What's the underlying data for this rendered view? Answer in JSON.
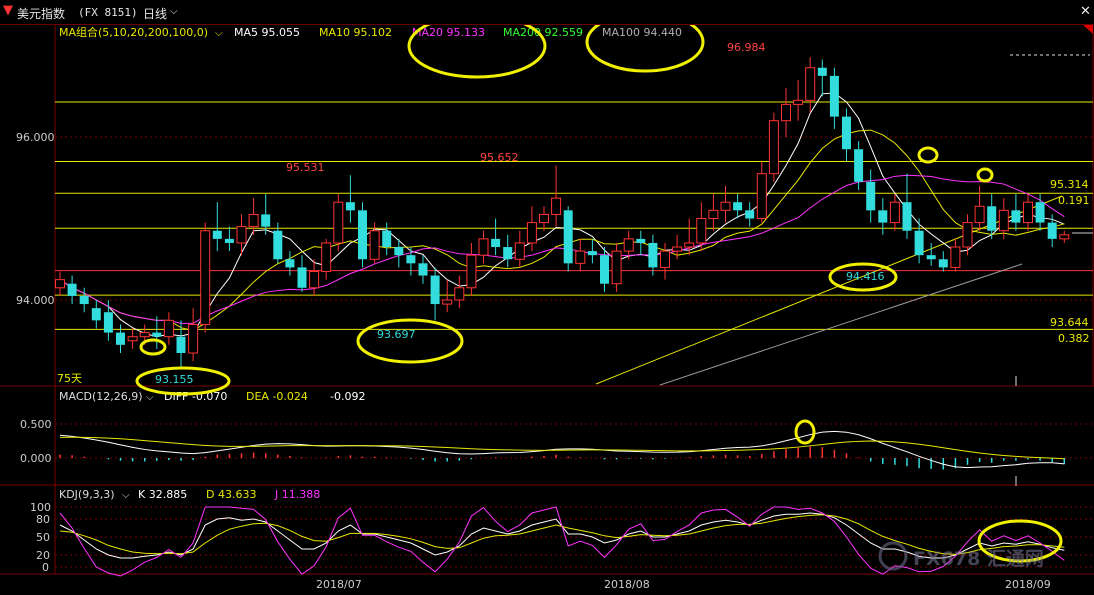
{
  "header": {
    "title": "美元指数",
    "symbol": "(FX 8151)",
    "period": "日线"
  },
  "ma_legend": {
    "name": "MA组合(5,10,20,200,100,0)",
    "items": [
      {
        "label": "MA5 95.055",
        "color": "#ffffff"
      },
      {
        "label": "MA10 95.102",
        "color": "#e8e800"
      },
      {
        "label": "MA20 95.133",
        "color": "#ff33ff"
      },
      {
        "label": "MA200 92.559",
        "color": "#33ff33"
      },
      {
        "label": "MA100 94.440",
        "color": "#b0b0b0"
      }
    ]
  },
  "price_axis": [
    "96.000",
    "94.000"
  ],
  "annotations": {
    "high1": "95.531",
    "high2": "95.652",
    "high3": "96.984",
    "low1": "93.155",
    "low2": "93.697",
    "low3": "94.416",
    "fib_high": "95.314",
    "fib_high_ratio": "0.191",
    "fib_low": "93.644",
    "fib_low_ratio": "0.382",
    "days": "75天"
  },
  "macd": {
    "legend": "MACD(12,26,9)",
    "diff": "DIFF -0.070",
    "dea": "DEA -0.024",
    "macd": "-0.092",
    "axis": [
      "0.500",
      "0.000"
    ]
  },
  "kdj": {
    "legend": "KDJ(9,3,3)",
    "k": "K 32.885",
    "d": "D 43.633",
    "j": "J 11.388",
    "axis": [
      "100",
      "80",
      "50",
      "20",
      "0"
    ]
  },
  "x_axis": [
    "2018/07",
    "2018/08",
    "2018/09"
  ],
  "watermark": "FX678 汇通网",
  "chart_data": {
    "type": "candlestick",
    "title": "美元指数 (FX 8151) 日线",
    "ylim": [
      93.0,
      97.3
    ],
    "candles": [
      [
        94.15,
        94.25,
        94.05,
        94.35
      ],
      [
        94.2,
        94.05,
        93.95,
        94.3
      ],
      [
        94.05,
        93.95,
        93.85,
        94.15
      ],
      [
        93.9,
        93.75,
        93.65,
        94.0
      ],
      [
        93.85,
        93.6,
        93.5,
        94.0
      ],
      [
        93.6,
        93.45,
        93.35,
        93.7
      ],
      [
        93.5,
        93.55,
        93.4,
        93.65
      ],
      [
        93.55,
        93.6,
        93.45,
        93.7
      ],
      [
        93.6,
        93.55,
        93.4,
        93.8
      ],
      [
        93.55,
        93.75,
        93.45,
        93.85
      ],
      [
        93.55,
        93.35,
        93.16,
        93.75
      ],
      [
        93.35,
        93.7,
        93.25,
        93.9
      ],
      [
        93.7,
        94.85,
        93.6,
        94.95
      ],
      [
        94.85,
        94.75,
        94.6,
        95.2
      ],
      [
        94.75,
        94.7,
        94.6,
        94.9
      ],
      [
        94.7,
        94.9,
        94.55,
        95.05
      ],
      [
        94.9,
        95.05,
        94.8,
        95.25
      ],
      [
        95.05,
        94.9,
        94.8,
        95.3
      ],
      [
        94.85,
        94.5,
        94.45,
        94.95
      ],
      [
        94.5,
        94.4,
        94.3,
        94.6
      ],
      [
        94.4,
        94.15,
        94.1,
        94.55
      ],
      [
        94.15,
        94.35,
        94.05,
        94.5
      ],
      [
        94.35,
        94.7,
        94.25,
        94.75
      ],
      [
        94.7,
        95.2,
        94.6,
        95.3
      ],
      [
        95.2,
        95.1,
        94.95,
        95.53
      ],
      [
        95.1,
        94.5,
        94.4,
        95.2
      ],
      [
        94.5,
        94.85,
        94.45,
        94.95
      ],
      [
        94.85,
        94.65,
        94.55,
        94.95
      ],
      [
        94.65,
        94.55,
        94.4,
        94.75
      ],
      [
        94.55,
        94.45,
        94.3,
        94.65
      ],
      [
        94.45,
        94.3,
        94.2,
        94.55
      ],
      [
        94.3,
        93.95,
        93.75,
        94.4
      ],
      [
        93.95,
        94.0,
        93.85,
        94.25
      ],
      [
        94.0,
        94.15,
        93.9,
        94.3
      ],
      [
        94.15,
        94.55,
        94.05,
        94.7
      ],
      [
        94.55,
        94.75,
        94.45,
        94.85
      ],
      [
        94.75,
        94.65,
        94.55,
        95.0
      ],
      [
        94.65,
        94.5,
        94.4,
        94.8
      ],
      [
        94.5,
        94.7,
        94.4,
        94.85
      ],
      [
        94.7,
        94.95,
        94.6,
        95.15
      ],
      [
        94.95,
        95.05,
        94.85,
        95.15
      ],
      [
        95.05,
        95.25,
        94.9,
        95.65
      ],
      [
        95.1,
        94.45,
        94.35,
        95.15
      ],
      [
        94.45,
        94.6,
        94.35,
        94.75
      ],
      [
        94.6,
        94.55,
        94.45,
        94.75
      ],
      [
        94.55,
        94.2,
        94.1,
        94.65
      ],
      [
        94.2,
        94.6,
        94.1,
        94.7
      ],
      [
        94.6,
        94.75,
        94.5,
        94.85
      ],
      [
        94.75,
        94.7,
        94.55,
        94.85
      ],
      [
        94.7,
        94.4,
        94.3,
        94.8
      ],
      [
        94.4,
        94.6,
        94.25,
        94.7
      ],
      [
        94.6,
        94.65,
        94.5,
        94.8
      ],
      [
        94.65,
        94.7,
        94.55,
        95.0
      ],
      [
        94.7,
        95.0,
        94.6,
        95.2
      ],
      [
        95.0,
        95.1,
        94.85,
        95.3
      ],
      [
        95.1,
        95.2,
        94.95,
        95.4
      ],
      [
        95.2,
        95.1,
        95.0,
        95.3
      ],
      [
        95.1,
        95.0,
        94.9,
        95.2
      ],
      [
        95.0,
        95.55,
        94.95,
        95.7
      ],
      [
        95.55,
        96.2,
        95.45,
        96.3
      ],
      [
        96.2,
        96.4,
        96.0,
        96.6
      ],
      [
        96.4,
        96.45,
        96.2,
        96.7
      ],
      [
        96.45,
        96.85,
        96.3,
        96.98
      ],
      [
        96.85,
        96.75,
        96.5,
        96.95
      ],
      [
        96.75,
        96.25,
        96.1,
        96.85
      ],
      [
        96.25,
        95.85,
        95.7,
        96.35
      ],
      [
        95.85,
        95.45,
        95.35,
        95.95
      ],
      [
        95.45,
        95.1,
        94.95,
        95.6
      ],
      [
        95.1,
        94.95,
        94.8,
        95.25
      ],
      [
        94.95,
        95.2,
        94.85,
        95.3
      ],
      [
        95.2,
        94.85,
        94.75,
        95.55
      ],
      [
        94.85,
        94.55,
        94.45,
        95.0
      ],
      [
        94.55,
        94.5,
        94.42,
        94.7
      ],
      [
        94.5,
        94.4,
        94.35,
        94.6
      ],
      [
        94.4,
        94.65,
        94.35,
        94.75
      ],
      [
        94.65,
        94.95,
        94.55,
        95.05
      ],
      [
        94.95,
        95.15,
        94.85,
        95.4
      ],
      [
        95.15,
        94.85,
        94.75,
        95.3
      ],
      [
        94.85,
        95.1,
        94.75,
        95.25
      ],
      [
        95.1,
        94.95,
        94.85,
        95.3
      ],
      [
        94.95,
        95.2,
        94.85,
        95.3
      ],
      [
        95.2,
        94.95,
        94.85,
        95.3
      ],
      [
        94.95,
        94.75,
        94.65,
        95.05
      ],
      [
        94.75,
        94.8,
        94.7,
        94.85
      ]
    ],
    "horizontal_levels": [
      {
        "value": 96.43,
        "color": "#e8e800"
      },
      {
        "value": 95.7,
        "color": "#e8e800"
      },
      {
        "value": 95.31,
        "color": "#e8e800"
      },
      {
        "value": 94.88,
        "color": "#e8e800"
      },
      {
        "value": 94.36,
        "color": "#ff3333"
      },
      {
        "value": 94.06,
        "color": "#e8e800"
      },
      {
        "value": 93.64,
        "color": "#e8e800"
      }
    ],
    "macd_bars": [
      0.05,
      0.04,
      0.02,
      0,
      -0.02,
      -0.04,
      -0.05,
      -0.05,
      -0.04,
      -0.03,
      -0.04,
      -0.03,
      0.02,
      0.05,
      0.06,
      0.07,
      0.08,
      0.07,
      0.05,
      0.03,
      0.01,
      0,
      0.01,
      0.03,
      0.04,
      0.02,
      0.02,
      0.01,
      0,
      -0.01,
      -0.03,
      -0.05,
      -0.05,
      -0.04,
      -0.02,
      0,
      0.01,
      0,
      0,
      0.02,
      0.03,
      0.05,
      0.02,
      0.01,
      0,
      -0.02,
      -0.02,
      -0.01,
      -0.01,
      -0.02,
      -0.01,
      0,
      0.01,
      0.03,
      0.04,
      0.05,
      0.04,
      0.03,
      0.06,
      0.1,
      0.13,
      0.15,
      0.17,
      0.16,
      0.12,
      0.07,
      0.01,
      -0.05,
      -0.09,
      -0.1,
      -0.12,
      -0.15,
      -0.16,
      -0.17,
      -0.15,
      -0.1,
      -0.06,
      -0.07,
      -0.04,
      -0.04,
      -0.02,
      -0.04,
      -0.06,
      -0.09
    ],
    "kdj_k": [
      70,
      60,
      45,
      30,
      20,
      15,
      15,
      18,
      20,
      25,
      20,
      30,
      70,
      80,
      82,
      78,
      80,
      75,
      60,
      45,
      30,
      30,
      40,
      60,
      70,
      55,
      55,
      50,
      45,
      40,
      30,
      20,
      25,
      35,
      55,
      65,
      60,
      55,
      60,
      70,
      75,
      80,
      55,
      55,
      50,
      40,
      45,
      55,
      60,
      50,
      50,
      55,
      60,
      70,
      75,
      78,
      75,
      70,
      78,
      85,
      88,
      88,
      90,
      88,
      82,
      70,
      55,
      40,
      30,
      30,
      25,
      18,
      15,
      15,
      20,
      30,
      40,
      35,
      40,
      38,
      42,
      38,
      32,
      28
    ],
    "kdj_d": [
      60,
      58,
      52,
      45,
      36,
      30,
      25,
      23,
      22,
      23,
      22,
      25,
      40,
      53,
      63,
      68,
      72,
      73,
      69,
      61,
      51,
      44,
      43,
      49,
      56,
      56,
      56,
      54,
      51,
      47,
      41,
      34,
      31,
      32,
      40,
      48,
      52,
      53,
      55,
      60,
      65,
      70,
      65,
      61,
      57,
      52,
      49,
      51,
      54,
      53,
      52,
      53,
      55,
      60,
      65,
      69,
      71,
      71,
      73,
      77,
      81,
      84,
      86,
      87,
      85,
      80,
      72,
      61,
      51,
      44,
      38,
      31,
      26,
      22,
      21,
      24,
      29,
      31,
      34,
      35,
      37,
      37,
      35,
      33
    ],
    "kdj_j": [
      90,
      65,
      31,
      0,
      -10,
      -15,
      -5,
      8,
      16,
      29,
      16,
      40,
      100,
      100,
      100,
      98,
      96,
      79,
      42,
      13,
      -12,
      2,
      34,
      82,
      98,
      53,
      53,
      42,
      33,
      26,
      8,
      -8,
      13,
      41,
      85,
      99,
      76,
      59,
      70,
      90,
      95,
      100,
      35,
      43,
      36,
      16,
      37,
      63,
      72,
      44,
      46,
      59,
      70,
      90,
      95,
      96,
      83,
      68,
      88,
      100,
      100,
      96,
      98,
      90,
      76,
      50,
      21,
      -2,
      -12,
      2,
      -1,
      -8,
      -7,
      1,
      18,
      42,
      62,
      43,
      52,
      44,
      52,
      40,
      26,
      11
    ]
  }
}
